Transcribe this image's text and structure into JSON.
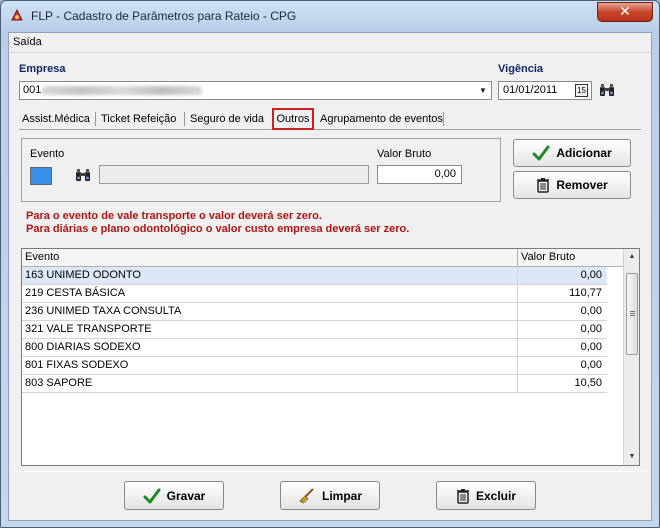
{
  "window": {
    "title": "FLP - Cadastro de Parâmetros para Rateio - CPG",
    "close_glyph": "✕"
  },
  "menu": {
    "saida": "Saída"
  },
  "empresa": {
    "label": "Empresa",
    "value": "001"
  },
  "vigencia": {
    "label": "Vigência",
    "value": "01/01/2011",
    "calendar_glyph": "15"
  },
  "tabs": [
    {
      "label": "Assist.Médica"
    },
    {
      "label": "Ticket Refeição"
    },
    {
      "label": "Seguro de vida"
    },
    {
      "label": "Outros",
      "active": true
    },
    {
      "label": "Agrupamento de eventos"
    }
  ],
  "form": {
    "evento_label": "Evento",
    "valor_bruto_label": "Valor Bruto",
    "valor_bruto_value": "0,00",
    "event_color": "#3a8ee6"
  },
  "buttons": {
    "adicionar": "Adicionar",
    "remover": "Remover",
    "gravar": "Gravar",
    "limpar": "Limpar",
    "excluir": "Excluir"
  },
  "warnings": [
    "Para o evento de vale transporte o valor deverá ser zero.",
    "Para diárias e plano odontológico o valor custo empresa deverá ser zero."
  ],
  "grid": {
    "columns": [
      "Evento",
      "Valor Bruto"
    ],
    "rows": [
      {
        "evento": "163 UNIMED ODONTO",
        "valor": "0,00",
        "selected": true
      },
      {
        "evento": "219 CESTA BÁSICA",
        "valor": "110,77"
      },
      {
        "evento": "236 UNIMED TAXA CONSULTA",
        "valor": "0,00"
      },
      {
        "evento": "321 VALE TRANSPORTE",
        "valor": "0,00"
      },
      {
        "evento": "800 DIARIAS SODEXO",
        "valor": "0,00"
      },
      {
        "evento": "801 FIXAS SODEXO",
        "valor": "0,00"
      },
      {
        "evento": "803 SAPORE",
        "valor": "10,50"
      }
    ]
  },
  "colors": {
    "accent_red": "#d01f1f",
    "warning_text": "#b01515",
    "label_blue": "#10276a"
  },
  "icons": [
    "app-icon",
    "close-icon",
    "calendar-icon",
    "binoculars-icon",
    "checkmark-icon",
    "trash-icon",
    "broom-icon"
  ]
}
